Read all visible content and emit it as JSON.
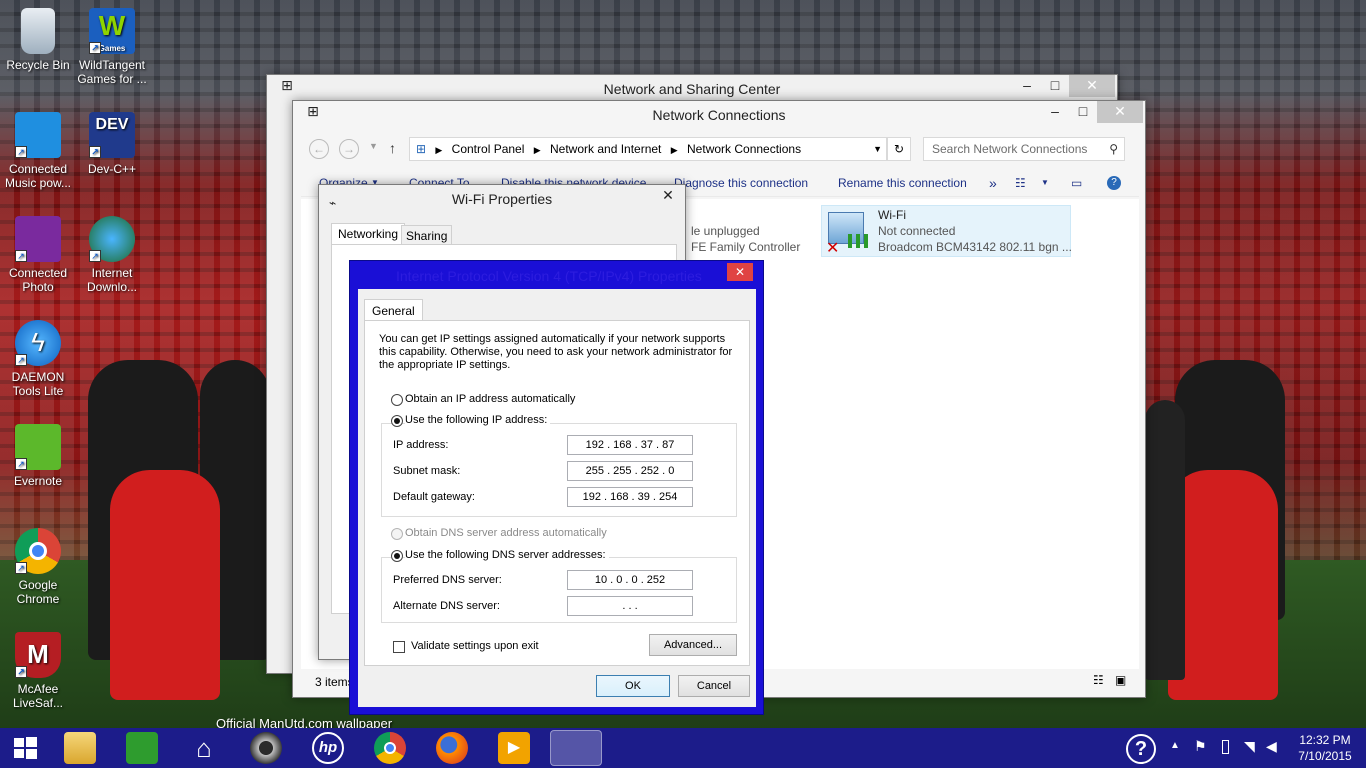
{
  "desktop": {
    "wallpaper_caption": "Official ManUtd.com wallpaper",
    "icons": [
      {
        "label": "Recycle Bin"
      },
      {
        "label": "WildTangent Games for ..."
      },
      {
        "label": "Connected Music pow..."
      },
      {
        "label": "Dev-C++"
      },
      {
        "label": "Connected Photo"
      },
      {
        "label": "Internet Downlo..."
      },
      {
        "label": "DAEMON Tools Lite"
      },
      {
        "label": "Evernote"
      },
      {
        "label": "Google Chrome"
      },
      {
        "label": "McAfee LiveSaf..."
      }
    ],
    "wildtangent_badge": "Games",
    "devcpp_badge": "DEV"
  },
  "nsc_window": {
    "title": "Network and Sharing Center"
  },
  "nc_window": {
    "title": "Network Connections",
    "breadcrumb": [
      "Control Panel",
      "Network and Internet",
      "Network Connections"
    ],
    "search_placeholder": "Search Network Connections",
    "toolbar": {
      "organize": "Organize",
      "connect_to": "Connect To",
      "disable": "Disable this network device",
      "diagnose": "Diagnose this connection",
      "rename": "Rename this connection",
      "more": "»"
    },
    "partial_adapter": {
      "line1": "le unplugged",
      "line2": "FE Family Controller"
    },
    "wifi_adapter": {
      "name": "Wi-Fi",
      "status": "Not connected",
      "device": "Broadcom BCM43142 802.11 bgn ..."
    },
    "status_bar": "3 items"
  },
  "wifi_props": {
    "title": "Wi-Fi Properties",
    "tabs": [
      "Networking",
      "Sharing"
    ]
  },
  "ipv4": {
    "title": "Internet Protocol Version 4 (TCP/IPv4) Properties",
    "tab": "General",
    "description": "You can get IP settings assigned automatically if your network supports this capability. Otherwise, you need to ask your network administrator for the appropriate IP settings.",
    "obtain_ip": "Obtain an IP address automatically",
    "use_ip": "Use the following IP address:",
    "ip_label": "IP address:",
    "ip_value": "192 . 168 . 37 . 87",
    "subnet_label": "Subnet mask:",
    "subnet_value": "255 . 255 . 252 . 0",
    "gateway_label": "Default gateway:",
    "gateway_value": "192 . 168 . 39 . 254",
    "obtain_dns": "Obtain DNS server address automatically",
    "use_dns": "Use the following DNS server addresses:",
    "pref_dns_label": "Preferred DNS server:",
    "pref_dns_value": "10 . 0 . 0 . 252",
    "alt_dns_label": "Alternate DNS server:",
    "alt_dns_value": ".       .       .",
    "validate": "Validate settings upon exit",
    "advanced": "Advanced...",
    "ok": "OK",
    "cancel": "Cancel"
  },
  "taskbar": {
    "time": "12:32 PM",
    "date": "7/10/2015",
    "pinned": [
      "start",
      "file-explorer",
      "store",
      "home",
      "webcam",
      "hp",
      "chrome",
      "firefox",
      "media-player",
      "network-connections"
    ]
  },
  "colors": {
    "taskbar": "#1c1c8a",
    "dialog_border": "#1a0fd6",
    "close": "#e04343"
  }
}
